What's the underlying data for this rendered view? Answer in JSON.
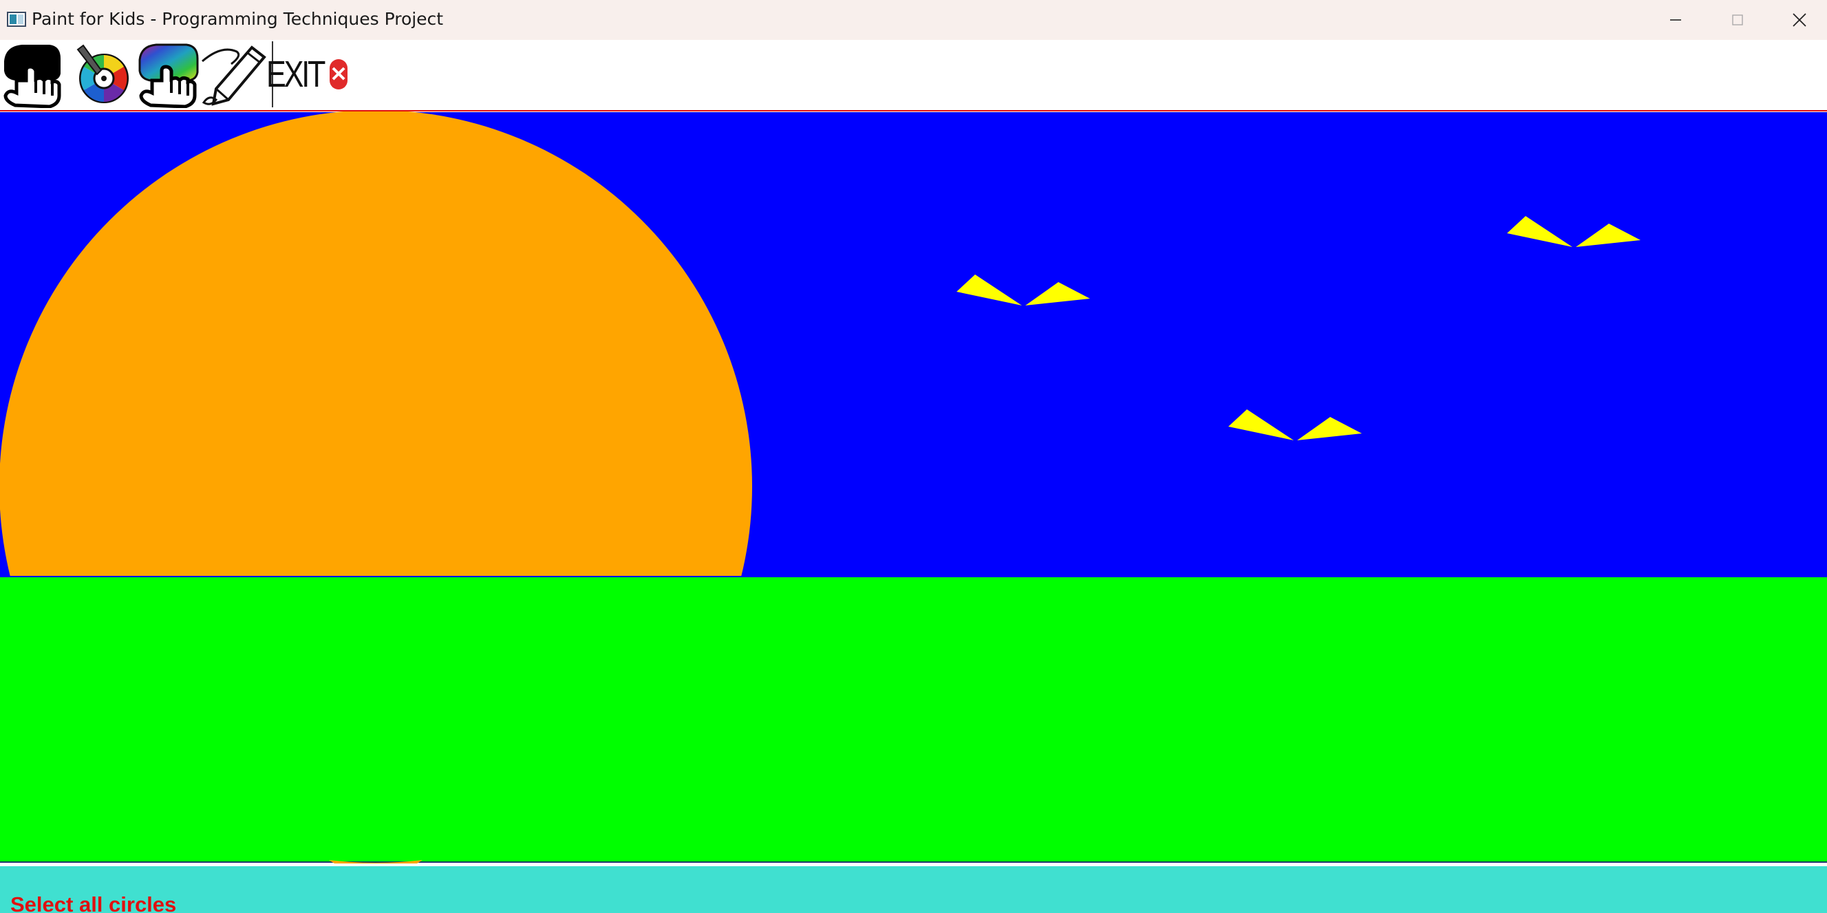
{
  "window": {
    "title": "Paint for Kids - Programming Techniques Project",
    "minimize_icon": "minimize-icon",
    "maximize_icon": "maximize-icon",
    "close_icon": "close-icon"
  },
  "toolbar": {
    "items": [
      {
        "name": "select-one-tool",
        "icon": "hand-pointer-icon"
      },
      {
        "name": "pick-color-tool",
        "icon": "color-wheel-icon"
      },
      {
        "name": "select-fill-tool",
        "icon": "hand-color-bar-icon"
      },
      {
        "name": "draw-mode-tool",
        "icon": "pencil-icon"
      },
      {
        "name": "exit-tool",
        "icon": "exit-icon"
      }
    ],
    "exit_label": "EXIT",
    "exit_badge": "✕",
    "separator_color": "#e01010"
  },
  "canvas": {
    "sky_color": "#0000ff",
    "ground_color": "#00ff00",
    "sun_color": "#ffa500",
    "bird_color": "#ffff00",
    "shapes": [
      "sky-rectangle",
      "ground-rectangle",
      "sun-circle",
      "bird-1",
      "bird-2",
      "bird-3"
    ]
  },
  "status": {
    "message": "Select all circles",
    "background_color": "#40e0d0",
    "text_color": "#e01010"
  }
}
